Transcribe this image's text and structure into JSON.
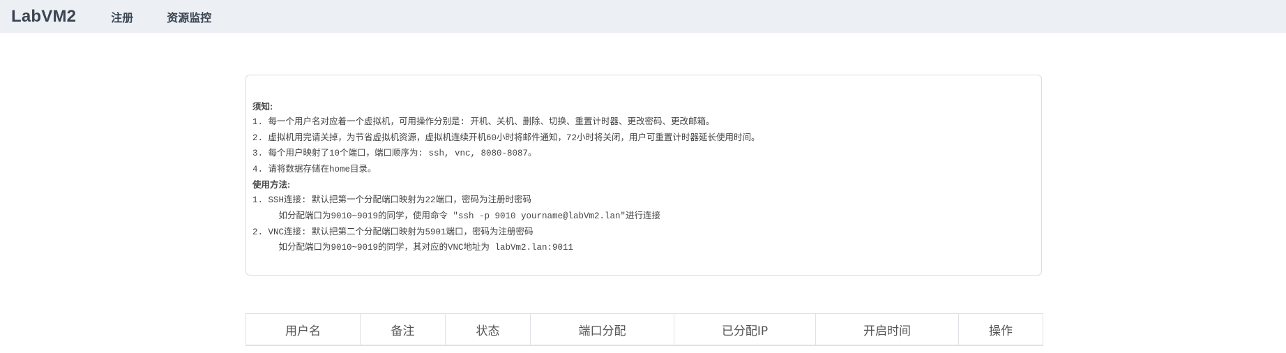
{
  "navbar": {
    "brand": "LabVM2",
    "links": [
      "注册",
      "资源监控"
    ]
  },
  "notice": {
    "notice_heading": "须知:",
    "notice_items": [
      "1. 每一个用户名对应着一个虚拟机，可用操作分别是: 开机、关机、删除、切换、重置计时器、更改密码、更改邮箱。",
      "2. 虚拟机用完请关掉，为节省虚拟机资源，虚拟机连续开机60小时将邮件通知，72小时将关闭，用户可重置计时器延长使用时间。",
      "3. 每个用户映射了10个端口，端口顺序为: ssh, vnc, 8080-8087。",
      "4. 请将数据存储在home目录。"
    ],
    "usage_heading": "使用方法:",
    "usage_items": [
      "1. SSH连接: 默认把第一个分配端口映射为22端口，密码为注册时密码",
      "     如分配端口为9010~9019的同学，使用命令 \"ssh -p 9010 yourname@labVm2.lan\"进行连接",
      "2. VNC连接: 默认把第二个分配端口映射为5901端口，密码为注册密码",
      "     如分配端口为9010~9019的同学，其对应的VNC地址为 labVm2.lan:9011"
    ]
  },
  "table": {
    "headers": [
      "用户名",
      "备注",
      "状态",
      "端口分配",
      "已分配IP",
      "开启时间",
      "操作"
    ]
  }
}
